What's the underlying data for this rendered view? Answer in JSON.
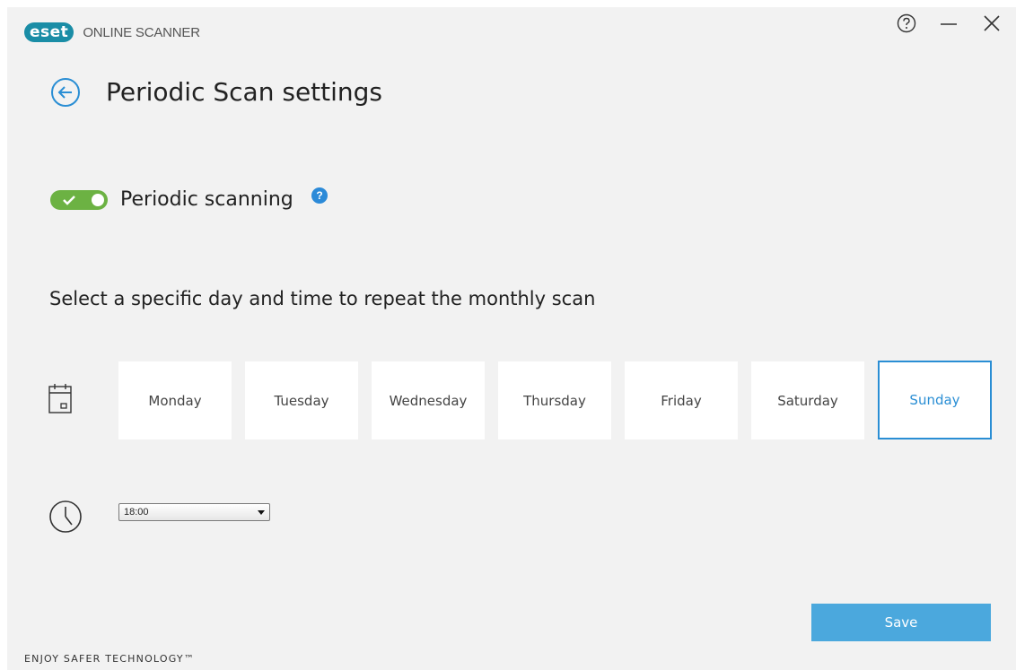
{
  "app": {
    "logo_badge": "eset",
    "logo_text": "ONLINE SCANNER",
    "footer": "ENJOY SAFER TECHNOLOGY™"
  },
  "window_controls": {
    "help_icon": "question-circle-icon",
    "minimize_icon": "minimize-icon",
    "close_icon": "close-icon"
  },
  "header": {
    "back_icon": "arrow-left-circle-icon",
    "title": "Periodic Scan settings"
  },
  "periodic": {
    "toggle_on": true,
    "label": "Periodic scanning",
    "info_text": "?"
  },
  "schedule": {
    "instruction": "Select a specific day and time to repeat the monthly scan",
    "calendar_icon": "calendar-icon",
    "days": [
      {
        "label": "Monday",
        "selected": false
      },
      {
        "label": "Tuesday",
        "selected": false
      },
      {
        "label": "Wednesday",
        "selected": false
      },
      {
        "label": "Thursday",
        "selected": false
      },
      {
        "label": "Friday",
        "selected": false
      },
      {
        "label": "Saturday",
        "selected": false
      },
      {
        "label": "Sunday",
        "selected": true
      }
    ],
    "clock_icon": "clock-icon",
    "time_value": "18:00"
  },
  "actions": {
    "save_label": "Save"
  },
  "colors": {
    "brand": "#1a8da6",
    "accent": "#2a8ed4",
    "toggle_on": "#6cb243",
    "save_button": "#4ba8dd",
    "background": "#f2f2f2"
  }
}
